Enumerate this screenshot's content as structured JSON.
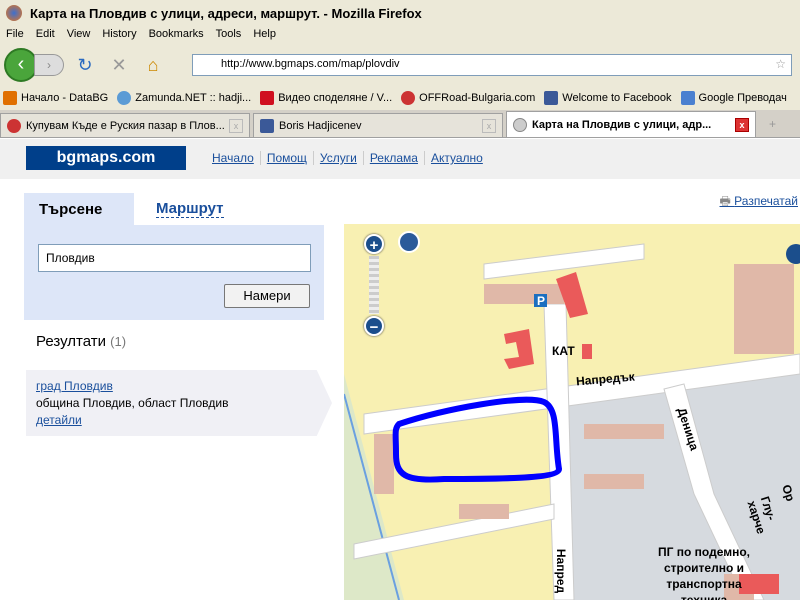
{
  "window": {
    "title": "Карта на Пловдив с улици, адреси, маршрут. - Mozilla Firefox"
  },
  "menu": [
    "File",
    "Edit",
    "View",
    "History",
    "Bookmarks",
    "Tools",
    "Help"
  ],
  "url": "http://www.bgmaps.com/map/plovdiv",
  "bookmarks": [
    "Начало - DataBG",
    "Zamunda.NET :: hadji...",
    "Видео споделяне / V...",
    "OFFRoad-Bulgaria.com",
    "Welcome to Facebook",
    "Google Преводач"
  ],
  "tabs": [
    "Купувам Къде е Руския пазар в Плов...",
    "Boris Hadjicenev",
    "Карта на Пловдив с улици, адр..."
  ],
  "site": {
    "logo": "bgmaps.com",
    "nav": [
      "Начало",
      "Помощ",
      "Услуги",
      "Реклама",
      "Актуално"
    ],
    "print": "Разпечатай"
  },
  "search": {
    "tab_search": "Търсене",
    "tab_route": "Маршрут",
    "query": "Пловдив",
    "button": "Намери"
  },
  "results": {
    "title": "Резултати",
    "count": "(1)",
    "items": [
      {
        "name": "град Пловдив",
        "desc": "община Пловдив, област Пловдив",
        "details": "детайли"
      }
    ]
  },
  "map": {
    "labels": [
      "КАТ",
      "P",
      "Напредък",
      "Деница",
      "Напред",
      "Глу-харче",
      "Ор",
      "ПГ по подемно, строително и транспортна техника"
    ]
  },
  "colors": {
    "accent": "#003f8a",
    "link": "#1a4f9c",
    "map_bg": "#f8f0b2",
    "route": "#0000ff"
  }
}
